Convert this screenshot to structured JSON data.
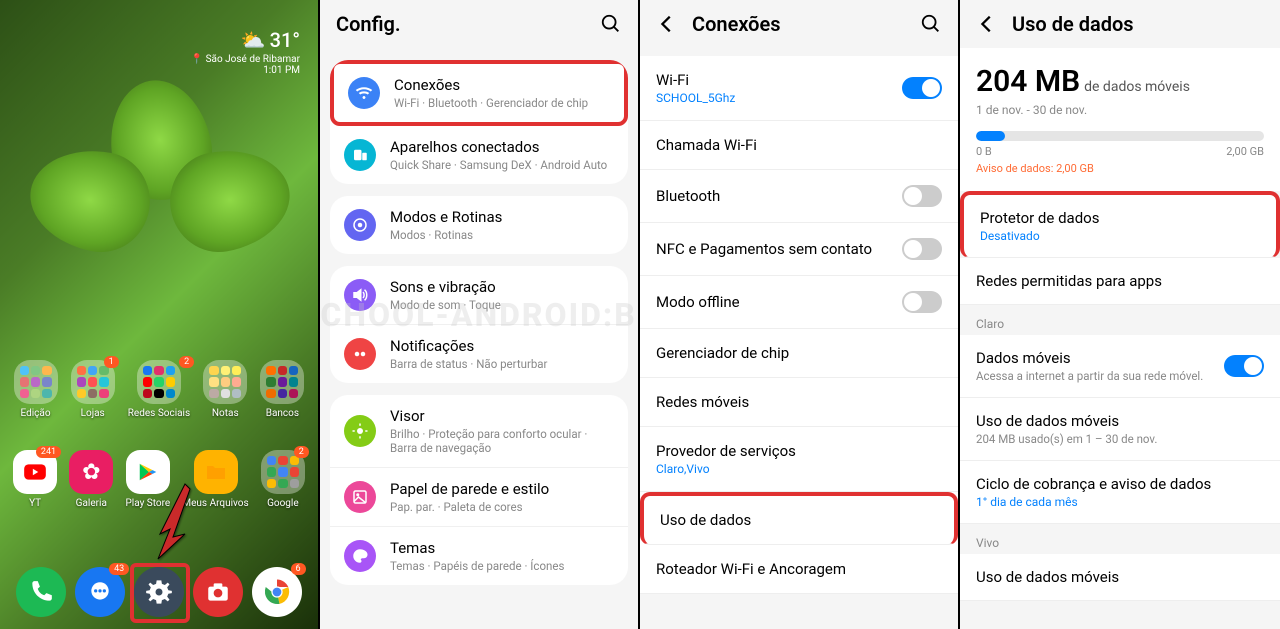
{
  "panel1": {
    "weather": {
      "temp": "31°",
      "location": "São José de Ribamar",
      "time": "1:01 PM"
    },
    "folders_row1": [
      {
        "label": "Edição",
        "colors": [
          "#4fc3f7",
          "#81c784",
          "#ffb74d",
          "#e57373",
          "#ba68c8",
          "#7986cb",
          "#f06292",
          "#aed581",
          "#4db6ac"
        ]
      },
      {
        "label": "Lojas",
        "badge": "1",
        "colors": [
          "#ff7043",
          "#42a5f5",
          "#66bb6a",
          "#ab47bc",
          "#ff5252",
          "#26c6da",
          "#ffca28",
          "#8d6e63",
          "#ec407a"
        ]
      },
      {
        "label": "Redes Sociais",
        "badge": "2",
        "colors": [
          "#1877f2",
          "#e1306c",
          "#1da1f2",
          "#ff0000",
          "#25d366",
          "#ffcc00",
          "#bd081c",
          "#000000",
          "#0088cc"
        ]
      },
      {
        "label": "Notas",
        "badge": "",
        "colors": [
          "#ffd54f",
          "#fff176",
          "#ffee58",
          "#ffe082",
          "#ffcc80",
          "#ffab91",
          "#bcaaa4",
          "#e0e0e0",
          "#b0bec5"
        ]
      },
      {
        "label": "Bancos",
        "colors": [
          "#ff6f00",
          "#c62828",
          "#1565c0",
          "#2e7d32",
          "#6a1b9a",
          "#00838f",
          "#ef6c00",
          "#4527a0",
          "#ad1457"
        ]
      }
    ],
    "folders_row2": [
      {
        "label": "YT",
        "badge": "241",
        "single": true
      },
      {
        "label": "Galeria",
        "single": true
      },
      {
        "label": "Play Store",
        "single": true
      },
      {
        "label": "Meus Arquivos",
        "single": true
      },
      {
        "label": "Google",
        "badge": "2",
        "colors": [
          "#4285f4",
          "#ea4335",
          "#fbbc05",
          "#34a853",
          "#4285f4",
          "#ea4335",
          "#fbbc05",
          "#34a853",
          "#9e9e9e"
        ]
      }
    ],
    "dock": [
      {
        "name": "phone",
        "badge": ""
      },
      {
        "name": "messages",
        "badge": "43"
      },
      {
        "name": "settings",
        "badge": ""
      },
      {
        "name": "camera",
        "badge": ""
      },
      {
        "name": "chrome",
        "badge": "6"
      }
    ]
  },
  "panel2": {
    "title": "Config.",
    "groups": [
      [
        {
          "icon": "wifi",
          "color": "#3b82f6",
          "title": "Conexões",
          "sub": "Wi-Fi · Bluetooth · Gerenciador de chip",
          "highlight": true
        },
        {
          "icon": "devices",
          "color": "#06b6d4",
          "title": "Aparelhos conectados",
          "sub": "Quick Share · Samsung DeX · Android Auto"
        }
      ],
      [
        {
          "icon": "routines",
          "color": "#6366f1",
          "title": "Modos e Rotinas",
          "sub": "Modos · Rotinas"
        }
      ],
      [
        {
          "icon": "sound",
          "color": "#8b5cf6",
          "title": "Sons e vibração",
          "sub": "Modo de som · Toque"
        },
        {
          "icon": "notif",
          "color": "#ef4444",
          "title": "Notificações",
          "sub": "Barra de status · Não perturbar"
        }
      ],
      [
        {
          "icon": "display",
          "color": "#84cc16",
          "title": "Visor",
          "sub": "Brilho · Proteção para conforto ocular · Barra de navegação"
        },
        {
          "icon": "wallpaper",
          "color": "#ec4899",
          "title": "Papel de parede e estilo",
          "sub": "Pap. par. · Paleta de cores"
        },
        {
          "icon": "themes",
          "color": "#a855f7",
          "title": "Temas",
          "sub": "Temas · Papéis de parede · Ícones"
        }
      ]
    ]
  },
  "panel3": {
    "title": "Conexões",
    "items": [
      {
        "title": "Wi-Fi",
        "sub": "SCHOOL_5Ghz",
        "subBlue": true,
        "toggle": true,
        "on": true
      },
      {
        "title": "Chamada Wi-Fi"
      },
      {
        "title": "Bluetooth",
        "toggle": true,
        "on": false
      },
      {
        "title": "NFC e Pagamentos sem contato",
        "toggle": true,
        "on": false
      },
      {
        "title": "Modo offline",
        "toggle": true,
        "on": false
      },
      {
        "title": "Gerenciador de chip"
      },
      {
        "title": "Redes móveis"
      },
      {
        "title": "Provedor de serviços",
        "sub": "Claro,Vivo",
        "subBlue": true
      },
      {
        "title": "Uso de dados",
        "highlight": true
      },
      {
        "title": "Roteador Wi-Fi e Ancoragem"
      }
    ]
  },
  "panel4": {
    "title": "Uso de dados",
    "usage": {
      "amount": "204 MB",
      "label": "de dados móveis",
      "period": "1 de nov. - 30 de nov.",
      "min": "0 B",
      "max": "2,00 GB",
      "warning": "Aviso de dados: 2,00 GB"
    },
    "items1": [
      {
        "title": "Protetor de dados",
        "sub": "Desativado",
        "subBlue": true,
        "highlight": true
      },
      {
        "title": "Redes permitidas para apps"
      }
    ],
    "section2": "Claro",
    "items2": [
      {
        "title": "Dados móveis",
        "sub": "Acessa a internet a partir da sua rede móvel.",
        "toggle": true,
        "on": true
      },
      {
        "title": "Uso de dados móveis",
        "sub": "204 MB usado(s) em 1 – 30 de nov."
      },
      {
        "title": "Ciclo de cobrança e aviso de dados",
        "sub": "1° dia de cada mês",
        "subBlue": true
      }
    ],
    "section3": "Vivo",
    "items3": [
      {
        "title": "Uso de dados móveis",
        "sub": ""
      }
    ]
  },
  "watermark": "SCHOOL-ANDROID:BR"
}
